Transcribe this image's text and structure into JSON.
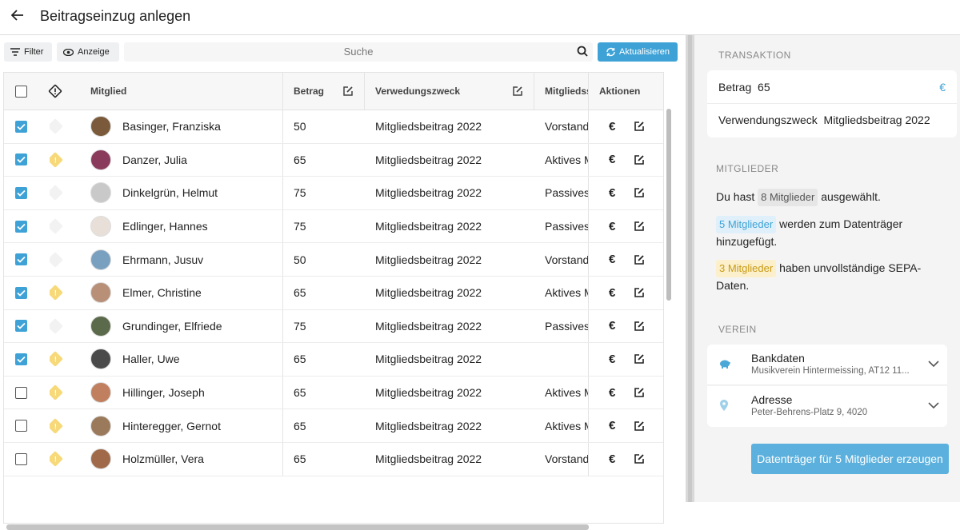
{
  "header": {
    "title": "Beitragseinzug anlegen"
  },
  "toolbar": {
    "filter_label": "Filter",
    "view_label": "Anzeige",
    "search_placeholder": "Suche",
    "refresh_label": "Aktualisieren"
  },
  "table": {
    "columns": {
      "member": "Mitglied",
      "amount": "Betrag",
      "purpose": "Verwedungszweck",
      "membership": "Mitgliedss",
      "actions": "Aktionen"
    },
    "rows": [
      {
        "checked": true,
        "warning": false,
        "name": "Basinger, Franziska",
        "amount": "50",
        "purpose": "Mitgliedsbeitrag 2022",
        "membership": "Vorstand",
        "avatar_color": "#7a5a3a"
      },
      {
        "checked": true,
        "warning": true,
        "name": "Danzer, Julia",
        "amount": "65",
        "purpose": "Mitgliedsbeitrag 2022",
        "membership": "Aktives M",
        "avatar_color": "#8a3a5a"
      },
      {
        "checked": true,
        "warning": false,
        "name": "Dinkelgrün, Helmut",
        "amount": "75",
        "purpose": "Mitgliedsbeitrag 2022",
        "membership": "Passives",
        "avatar_color": "#c9c9c9"
      },
      {
        "checked": true,
        "warning": false,
        "name": "Edlinger, Hannes",
        "amount": "75",
        "purpose": "Mitgliedsbeitrag 2022",
        "membership": "Passives",
        "avatar_color": "#e8e0d8"
      },
      {
        "checked": true,
        "warning": false,
        "name": "Ehrmann, Jusuv",
        "amount": "50",
        "purpose": "Mitgliedsbeitrag 2022",
        "membership": "Vorstand",
        "avatar_color": "#7aa0c0"
      },
      {
        "checked": true,
        "warning": true,
        "name": "Elmer, Christine",
        "amount": "65",
        "purpose": "Mitgliedsbeitrag 2022",
        "membership": "Aktives M",
        "avatar_color": "#b89078"
      },
      {
        "checked": true,
        "warning": false,
        "name": "Grundinger, Elfriede",
        "amount": "75",
        "purpose": "Mitgliedsbeitrag 2022",
        "membership": "Passives",
        "avatar_color": "#5a6a4a"
      },
      {
        "checked": true,
        "warning": true,
        "name": "Haller, Uwe",
        "amount": "65",
        "purpose": "Mitgliedsbeitrag 2022",
        "membership": "",
        "avatar_color": "#4a4a4a"
      },
      {
        "checked": false,
        "warning": true,
        "name": "Hillinger, Joseph",
        "amount": "65",
        "purpose": "Mitgliedsbeitrag 2022",
        "membership": "Aktives M",
        "avatar_color": "#c08060"
      },
      {
        "checked": false,
        "warning": true,
        "name": "Hinteregger, Gernot",
        "amount": "65",
        "purpose": "Mitgliedsbeitrag 2022",
        "membership": "Aktives M",
        "avatar_color": "#9a7a5a"
      },
      {
        "checked": false,
        "warning": true,
        "name": "Holzmüller, Vera",
        "amount": "65",
        "purpose": "Mitgliedsbeitrag 2022",
        "membership": "Vorstand",
        "avatar_color": "#a06a4a"
      }
    ]
  },
  "panel": {
    "transaction": {
      "heading": "TRANSAKTION",
      "amount_label": "Betrag",
      "amount_value": "65",
      "currency": "€",
      "purpose_label": "Verwendungszweck",
      "purpose_value": "Mitgliedsbeitrag 2022"
    },
    "members": {
      "heading": "MITGLIEDER",
      "selected_prefix": "Du hast",
      "selected_badge": "8 Mitglieder",
      "selected_suffix": "ausgewählt.",
      "added_badge": "5 Mitglieder",
      "added_text": "werden zum Datenträger hinzugefügt.",
      "incomplete_badge": "3 Mitglieder",
      "incomplete_text": "haben unvollständige SEPA-Daten."
    },
    "club": {
      "heading": "VEREIN",
      "bank_title": "Bankdaten",
      "bank_sub": "Musikverein Hintermeissing, AT12 11...",
      "address_title": "Adresse",
      "address_sub": "Peter-Behrens-Platz 9, 4020"
    },
    "generate_label": "Datenträger für 5 Mitglieder erzeugen"
  },
  "colors": {
    "accent": "#3ea2d6",
    "warning": "#f7d979"
  }
}
